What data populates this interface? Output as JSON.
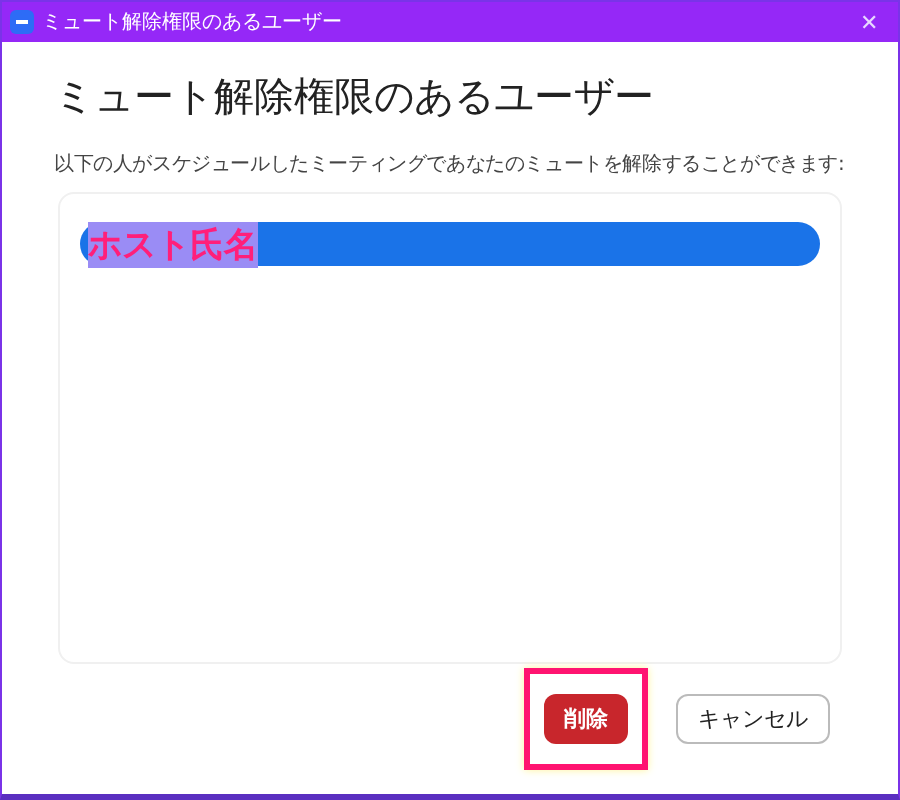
{
  "window": {
    "title": "ミュート解除権限のあるユーザー",
    "close": "✕"
  },
  "heading": "ミュート解除権限のあるユーザー",
  "description": "以下の人がスケジュールしたミーティングであなたのミュートを解除することができます:",
  "users": [
    {
      "name": "ホスト氏名",
      "selected": true
    }
  ],
  "buttons": [
    {
      "label": "削除",
      "kind": "danger",
      "highlighted": true
    },
    {
      "label": "キャンセル",
      "kind": "plain",
      "highlighted": false
    }
  ]
}
